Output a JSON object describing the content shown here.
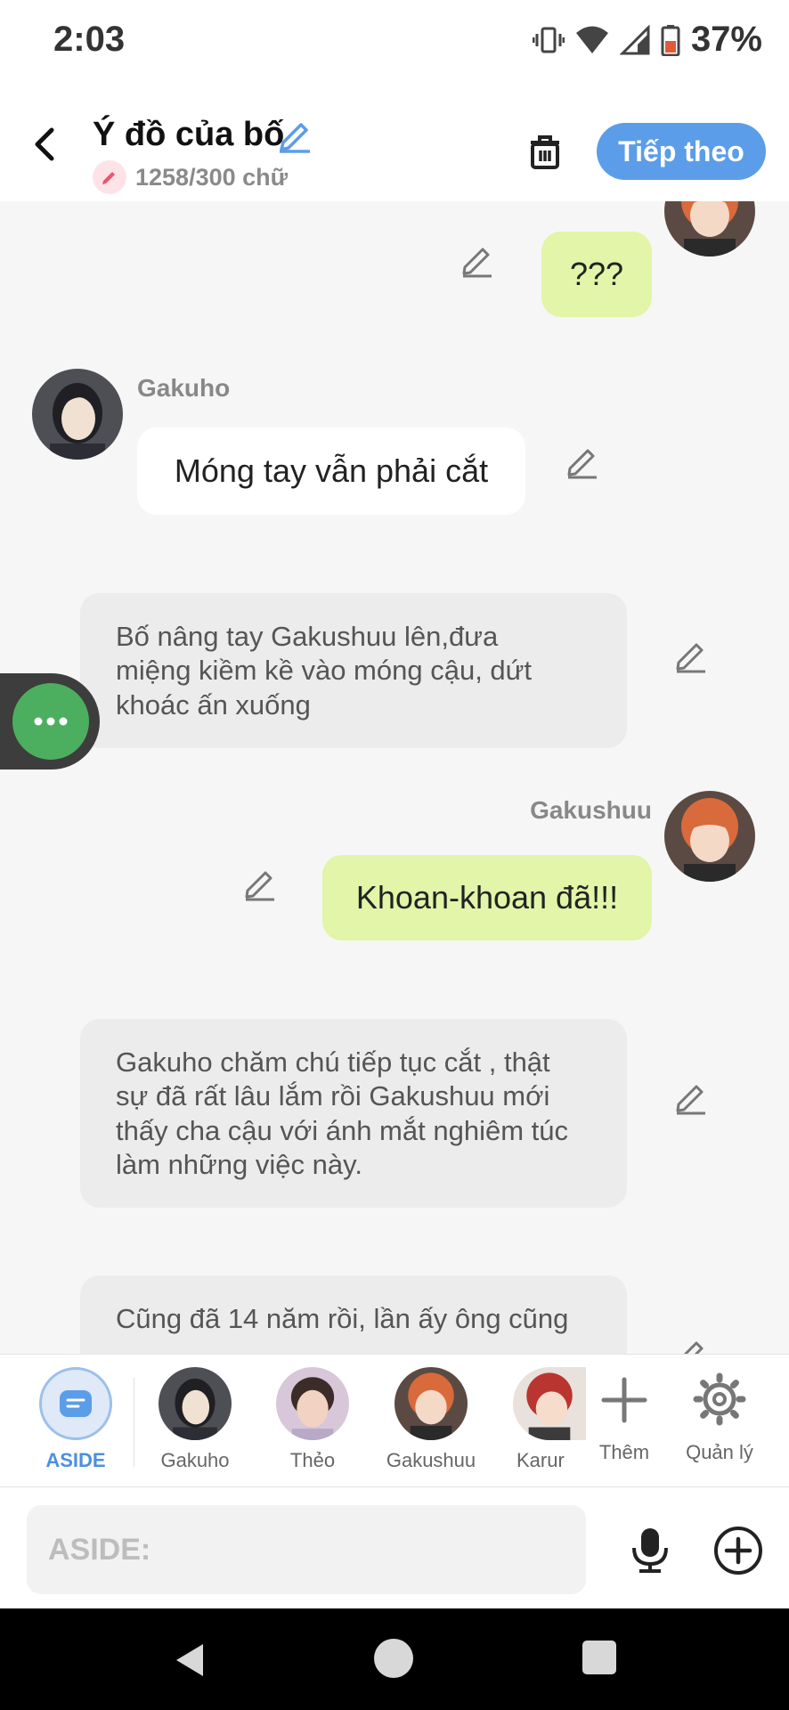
{
  "status": {
    "time": "2:03",
    "battery": "37%"
  },
  "header": {
    "title": "Ý đồ của bố",
    "word_count": "1258/300 chữ",
    "next_label": "Tiếp theo"
  },
  "messages": [
    {
      "type": "right",
      "speaker": "",
      "text": "???"
    },
    {
      "type": "left",
      "speaker": "Gakuho",
      "text": "Móng tay vẫn phải cắt"
    },
    {
      "type": "narration",
      "lines": [
        "Bố nâng tay Gakushuu lên,đưa",
        "miệng kiềm kề vào móng cậu, dứt",
        "khoác ấn xuống"
      ]
    },
    {
      "type": "right",
      "speaker": "Gakushuu",
      "text": "Khoan-khoan đã!!!"
    },
    {
      "type": "narration",
      "lines": [
        "Gakuho chăm chú tiếp tục cắt , thật",
        "sự đã rất lâu lắm rồi Gakushuu mới",
        "thấy cha cậu với ánh mắt nghiêm túc",
        "làm những việc này."
      ]
    },
    {
      "type": "narration",
      "lines": [
        "Cũng đã 14 năm rồi, lần ấy ông cũng"
      ]
    }
  ],
  "characters": [
    {
      "label": "ASIDE",
      "icon": "aside-icon"
    },
    {
      "label": "Gakuho",
      "icon": "avatar-gakuho"
    },
    {
      "label": "Thẻo",
      "icon": "avatar-theo"
    },
    {
      "label": "Gakushuu",
      "icon": "avatar-gakushuu"
    },
    {
      "label": "Karur",
      "icon": "avatar-karma"
    },
    {
      "label": "Thêm",
      "icon": "plus-icon"
    },
    {
      "label": "Quản lý",
      "icon": "gear-icon"
    }
  ],
  "input": {
    "placeholder": "ASIDE:"
  },
  "colors": {
    "accent": "#5b9de8",
    "aside_label": "#4d8fe0",
    "bubble_right": "#e2f5a8",
    "narration_bg": "#ececec",
    "fab": "#4caf5f"
  }
}
